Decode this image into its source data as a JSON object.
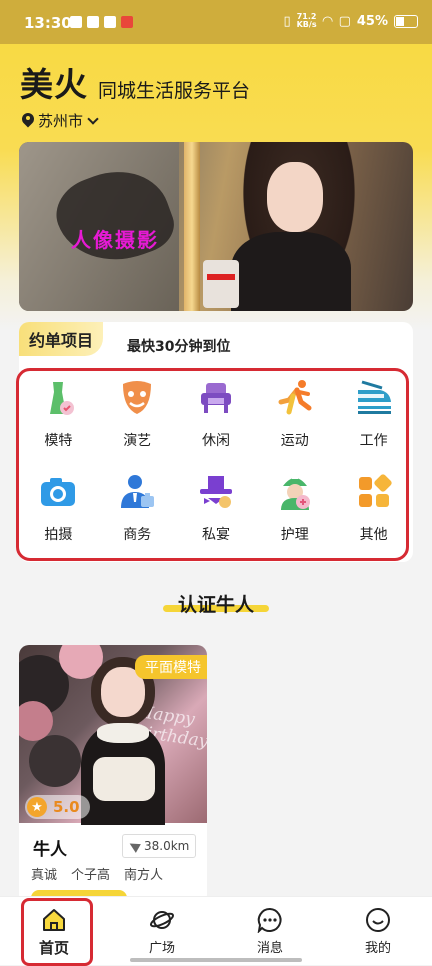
{
  "status_bar": {
    "time": "13:30",
    "net_speed_value": "71.2",
    "net_speed_unit": "KB/s",
    "battery": "45%"
  },
  "header": {
    "brand": "美火",
    "slogan": "同城生活服务平台",
    "city": "苏州市"
  },
  "banner": {
    "caption": "人像摄影"
  },
  "order_section": {
    "title": "约单项目",
    "subtitle": "最快30分钟到位",
    "items": [
      {
        "label": "模特",
        "icon": "model-dress-icon"
      },
      {
        "label": "演艺",
        "icon": "theater-mask-icon"
      },
      {
        "label": "休闲",
        "icon": "armchair-icon"
      },
      {
        "label": "运动",
        "icon": "runner-icon"
      },
      {
        "label": "工作",
        "icon": "train-icon"
      },
      {
        "label": "拍摄",
        "icon": "camera-icon"
      },
      {
        "label": "商务",
        "icon": "business-person-icon"
      },
      {
        "label": "私宴",
        "icon": "banquet-hat-icon"
      },
      {
        "label": "护理",
        "icon": "nurse-icon"
      },
      {
        "label": "其他",
        "icon": "other-grid-icon"
      }
    ]
  },
  "certified": {
    "title": "认证牛人",
    "card": {
      "badge": "平面模特",
      "rating": "5.0",
      "name": "牛人",
      "distance": "38.0km",
      "traits": [
        "真诚",
        "个子高",
        "南方人"
      ],
      "photo_text": "Happy birthday"
    }
  },
  "tabbar": {
    "tabs": [
      {
        "label": "首页",
        "icon": "home-icon",
        "active": true
      },
      {
        "label": "广场",
        "icon": "planet-icon",
        "active": false
      },
      {
        "label": "消息",
        "icon": "chat-bubble-icon",
        "active": false
      },
      {
        "label": "我的",
        "icon": "smiley-face-icon",
        "active": false
      }
    ]
  },
  "colors": {
    "accent": "#f8d93e",
    "highlight_outline": "#d62a33",
    "badge": "#f5c52c"
  }
}
